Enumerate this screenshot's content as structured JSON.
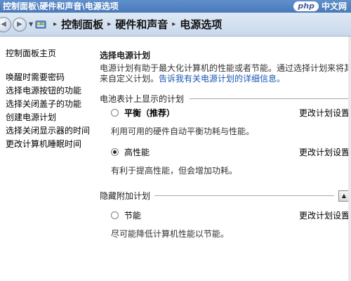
{
  "window": {
    "title": "控制面板\\硬件和声音\\电源选项"
  },
  "watermark": {
    "logo": "php",
    "text": "中文网"
  },
  "address": {
    "crumbs": [
      "控制面板",
      "硬件和声音",
      "电源选项"
    ]
  },
  "sidebar": {
    "home": "控制面板主页",
    "items": [
      "唤醒时需要密码",
      "选择电源按钮的功能",
      "选择关闭盖子的功能",
      "创建电源计划",
      "选择关闭显示器的时间",
      "更改计算机睡眠时间"
    ]
  },
  "main": {
    "title": "选择电源计划",
    "desc_line1": "电源计划有助于最大化计算机的性能或者节能。通过选择计划来将其",
    "desc_line2_prefix": "来自定义计划。",
    "desc_link": "告诉我有关电源计划的详细信息。",
    "group_battery": "电池表计上显示的计划",
    "plans": [
      {
        "name": "平衡（推荐）",
        "desc": "利用可用的硬件自动平衡功耗与性能。",
        "settings": "更改计划设置",
        "selected": false
      },
      {
        "name": "高性能",
        "desc": "有利于提高性能，但会增加功耗。",
        "settings": "更改计划设置",
        "selected": true
      }
    ],
    "group_hidden": "隐藏附加计划",
    "hidden_plans": [
      {
        "name": "节能",
        "desc": "尽可能降低计算机性能以节能。",
        "settings": "更改计划设置",
        "selected": false
      }
    ]
  }
}
